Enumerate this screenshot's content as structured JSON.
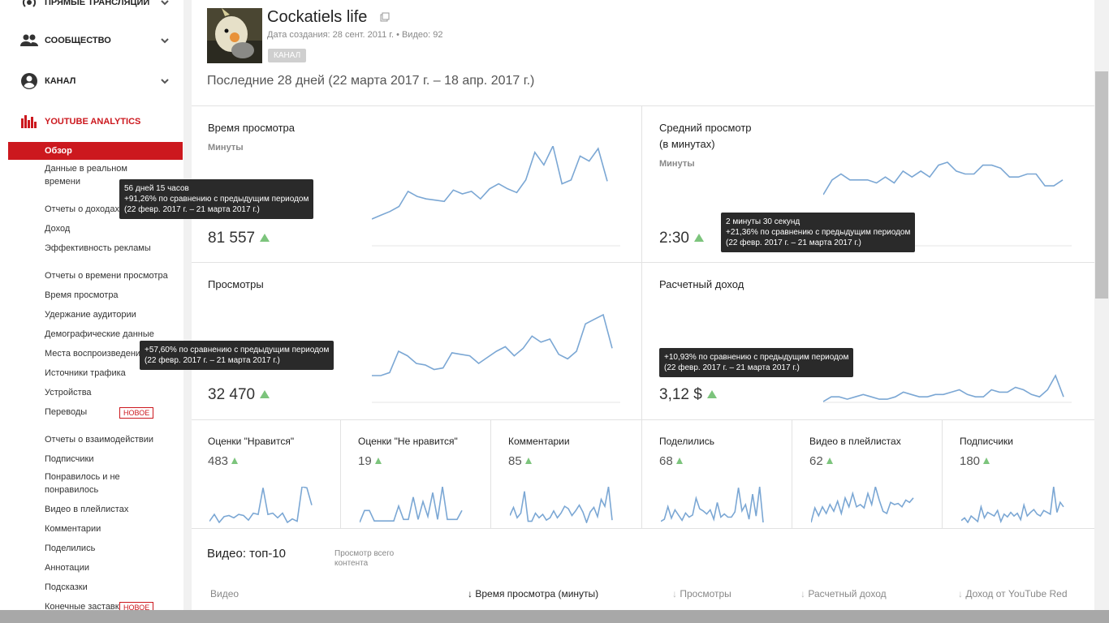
{
  "sidebar": {
    "sections": [
      {
        "label": "ПРЯМЫЕ ТРАНСЛЯЦИИ",
        "icon": "live-icon"
      },
      {
        "label": "СООБЩЕСТВО",
        "icon": "community-icon"
      },
      {
        "label": "КАНАЛ",
        "icon": "account-icon"
      },
      {
        "label": "YOUTUBE ANALYTICS",
        "icon": "analytics-icon"
      }
    ],
    "items": [
      "Обзор",
      "Данные в реальном времени",
      "Отчеты о доходах",
      "Доход",
      "Эффективность рекламы",
      "Отчеты о времени просмотра",
      "Время просмотра",
      "Удержание аудитории",
      "Демографические данные",
      "Места воспроизведения",
      "Источники трафика",
      "Устройства",
      "Переводы",
      "Отчеты о взаимодействии",
      "Подписчики",
      "Понравилось и не понравилось",
      "Видео в плейлистах",
      "Комментарии",
      "Поделились",
      "Аннотации",
      "Подсказки",
      "Конечные заставки"
    ],
    "new_badge": "НОВОЕ"
  },
  "channel": {
    "title": "Cockatiels life",
    "meta": "Дата создания: 28 сент. 2011 г.  •  Видео: 92",
    "badge": "КАНАЛ"
  },
  "period": "Последние 28 дней (22 марта 2017 г. – 18 апр. 2017 г.)",
  "cards": [
    {
      "title": "Время просмотра",
      "unit": "Минуты",
      "value": "81 557"
    },
    {
      "title_line1": "Средний просмотр",
      "title_line2": "(в минутах)",
      "unit": "Минуты",
      "value": "2:30"
    },
    {
      "title": "Просмотры",
      "value": "32 470"
    },
    {
      "title": "Расчетный доход",
      "value": "3,12 $"
    }
  ],
  "tooltips": [
    {
      "line1": "56 дней 15 часов",
      "line2": "+91,26% по сравнению с предыдущим периодом",
      "line3": "(22 февр. 2017 г. – 21 марта 2017 г.)"
    },
    {
      "line1": "2 минуты 30 секунд",
      "line2": "+21,36% по сравнению с предыдущим периодом",
      "line3": "(22 февр. 2017 г. – 21 марта 2017 г.)"
    },
    {
      "line1": "+57,60% по сравнению с предыдущим периодом",
      "line2": "(22 февр. 2017 г. – 21 марта 2017 г.)"
    },
    {
      "line1": "+10,93% по сравнению с предыдущим периодом",
      "line2": "(22 февр. 2017 г. – 21 марта 2017 г.)"
    }
  ],
  "mini_cards": [
    {
      "title": "Оценки \"Нравится\"",
      "value": "483"
    },
    {
      "title": "Оценки \"Не нравится\"",
      "value": "19"
    },
    {
      "title": "Комментарии",
      "value": "85"
    },
    {
      "title": "Поделились",
      "value": "68"
    },
    {
      "title": "Видео в плейлистах",
      "value": "62"
    },
    {
      "title": "Подписчики",
      "value": "180"
    }
  ],
  "top10": {
    "title": "Видео: топ-10",
    "note": "Просмотр всего контента",
    "columns": [
      "Видео",
      "Время просмотра (минуты)",
      "Просмотры",
      "Расчетный доход",
      "Доход от YouTube Red"
    ]
  },
  "chart_data": [
    {
      "type": "line",
      "series_title": "Время просмотра",
      "values": [
        2,
        5,
        8,
        12,
        24,
        20,
        18,
        17,
        16,
        25,
        22,
        24,
        18,
        26,
        30,
        26,
        23,
        33,
        55,
        45,
        60,
        30,
        33,
        52,
        48,
        58,
        32
      ]
    },
    {
      "type": "line",
      "series_title": "Средний просмотр",
      "values": [
        42,
        47,
        49,
        47,
        47,
        47,
        46,
        48,
        46,
        50,
        48,
        50,
        48,
        52,
        53,
        50,
        49,
        49,
        52,
        52,
        51,
        48,
        48,
        49,
        49,
        45,
        45,
        47
      ]
    },
    {
      "type": "line",
      "series_title": "Просмотры",
      "values": [
        4,
        4,
        6,
        20,
        17,
        12,
        11,
        8,
        9,
        19,
        18,
        17,
        12,
        16,
        20,
        23,
        17,
        22,
        30,
        26,
        28,
        18,
        15,
        20,
        38,
        41,
        44,
        22
      ]
    },
    {
      "type": "line",
      "series_title": "Расчетный доход",
      "values": [
        1,
        3,
        3,
        2,
        3,
        4,
        3,
        2,
        2,
        3,
        5,
        4,
        3,
        3,
        4,
        4,
        5,
        6,
        4,
        3,
        3,
        6,
        5,
        5,
        7,
        6,
        4,
        3,
        6,
        12,
        3
      ]
    },
    {
      "type": "line",
      "series_title": "Оценки Нравится",
      "values": [
        4,
        10,
        3,
        8,
        9,
        7,
        10,
        9,
        5,
        11,
        10,
        33,
        10,
        11,
        7,
        11,
        3,
        6,
        4,
        34,
        33,
        18
      ]
    },
    {
      "type": "line",
      "series_title": "Оценки Не нравится",
      "values": [
        2,
        10,
        10,
        3,
        3,
        3,
        3,
        3,
        13,
        4,
        4,
        19,
        4,
        16,
        6,
        22,
        4,
        26,
        4,
        4,
        4,
        10
      ]
    },
    {
      "type": "line",
      "series_title": "Комментарии",
      "values": [
        8,
        15,
        6,
        10,
        29,
        3,
        3,
        10,
        6,
        9,
        4,
        6,
        12,
        6,
        10,
        16,
        14,
        8,
        12,
        17,
        11,
        2,
        11,
        15,
        7,
        22,
        16,
        33,
        4
      ]
    },
    {
      "type": "line",
      "series_title": "Поделились",
      "values": [
        4,
        6,
        18,
        7,
        15,
        10,
        5,
        12,
        8,
        10,
        26,
        16,
        14,
        11,
        15,
        6,
        22,
        8,
        11,
        8,
        8,
        13,
        36,
        14,
        20,
        6,
        30,
        9,
        37,
        3
      ]
    },
    {
      "type": "line",
      "series_title": "Видео в плейлистах",
      "values": [
        2,
        15,
        8,
        16,
        10,
        18,
        12,
        21,
        10,
        24,
        16,
        28,
        16,
        18,
        15,
        28,
        18,
        34,
        22,
        12,
        10,
        20,
        18,
        19,
        16,
        22,
        20,
        24
      ]
    },
    {
      "type": "line",
      "series_title": "Подписчики",
      "values": [
        5,
        8,
        3,
        10,
        7,
        4,
        20,
        8,
        14,
        12,
        10,
        16,
        4,
        12,
        9,
        14,
        10,
        13,
        6,
        22,
        10,
        14,
        17,
        12,
        10,
        16,
        14,
        12,
        42,
        14,
        25,
        20
      ]
    }
  ]
}
